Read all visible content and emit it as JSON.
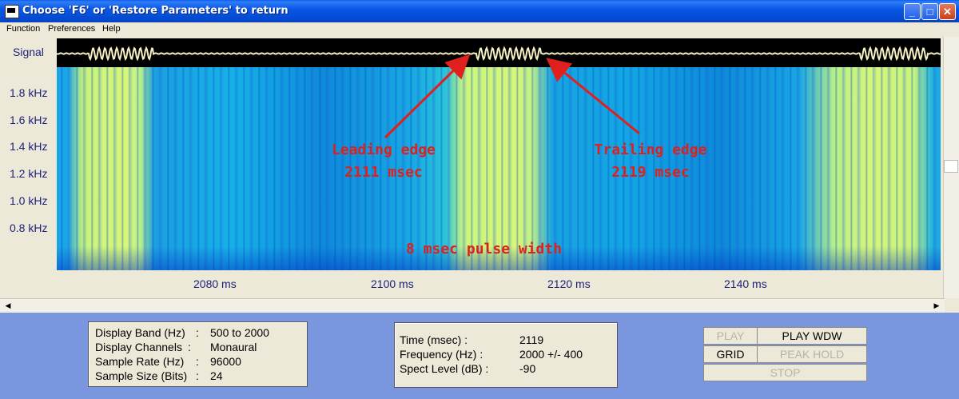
{
  "window": {
    "title": "Choose 'F6' or 'Restore Parameters' to return",
    "minimize_glyph": "_",
    "maximize_glyph": "□",
    "close_glyph": "✕"
  },
  "menu": {
    "items": [
      "Function",
      "Preferences",
      "Help"
    ]
  },
  "plot": {
    "signal_label": "Signal",
    "y_ticks": [
      "1.8 kHz",
      "1.6 kHz",
      "1.4 kHz",
      "1.2 kHz",
      "1.0 kHz",
      "0.8 kHz"
    ],
    "x_ticks": [
      "2080 ms",
      "2100 ms",
      "2120 ms",
      "2140 ms"
    ],
    "annotations": {
      "leading_line1": "Leading edge",
      "leading_line2": "2111 msec",
      "trailing_line1": "Trailing edge",
      "trailing_line2": "2119 msec",
      "pulse_width": "8 msec pulse width"
    },
    "colors": {
      "annotation": "#e0201c",
      "signal_trace": "#f4efc0",
      "label": "#1b1f7a"
    }
  },
  "info_left": {
    "rows": [
      {
        "label": "Display Band (Hz)",
        "value": "500 to 2000"
      },
      {
        "label": "Display Channels",
        "value": "Monaural"
      },
      {
        "label": "Sample Rate (Hz)",
        "value": "96000"
      },
      {
        "label": "Sample Size (Bits)",
        "value": "24"
      }
    ],
    "sep": ":"
  },
  "info_mid": {
    "rows": [
      {
        "label": "Time (msec) :",
        "value": "2119"
      },
      {
        "label": "Frequency (Hz) :",
        "value": "2000 +/- 400"
      },
      {
        "label": "Spect Level (dB) :",
        "value": "-90"
      }
    ]
  },
  "buttons": {
    "play": "PLAY",
    "play_wdw": "PLAY WDW",
    "grid": "GRID",
    "peak_hold": "PEAK HOLD",
    "stop": "STOP"
  },
  "scroll": {
    "left": "◀",
    "right": "▶",
    "up": "▲",
    "down": "▼"
  }
}
